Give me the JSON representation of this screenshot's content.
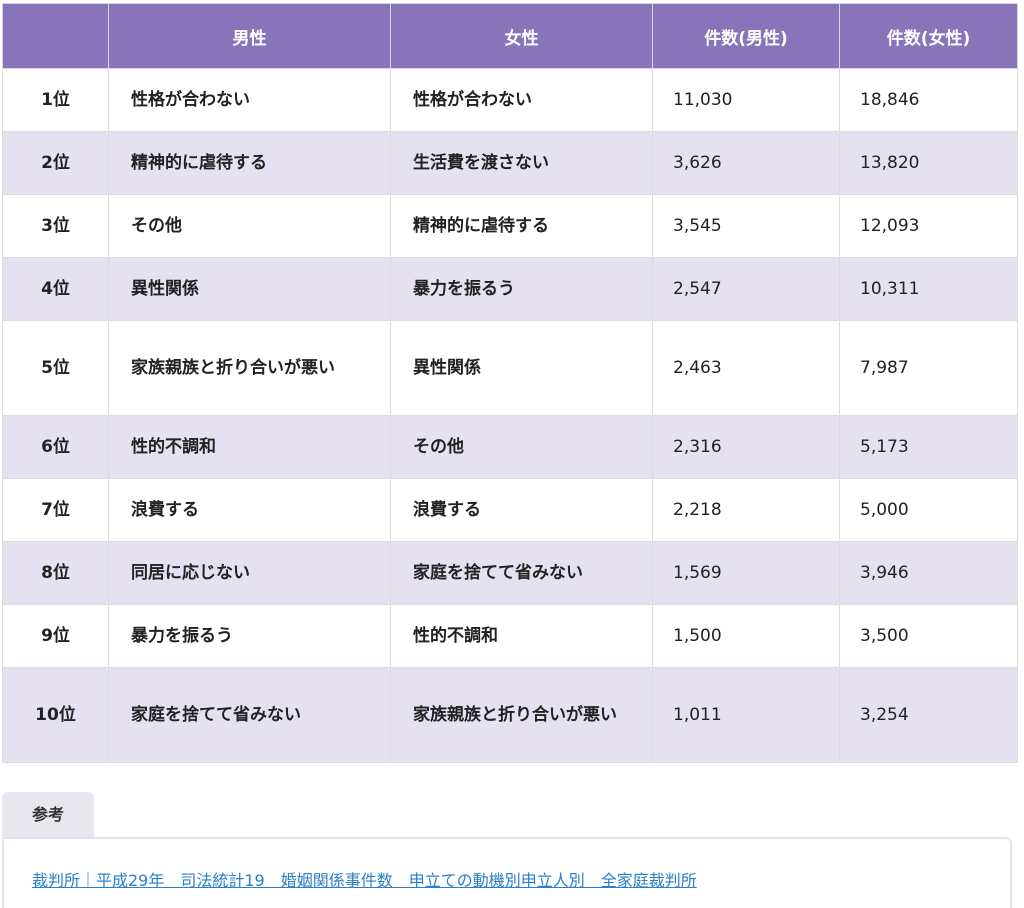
{
  "table": {
    "headers": [
      "",
      "男性",
      "女性",
      "件数(男性)",
      "件数(女性)"
    ],
    "rows": [
      {
        "rank": "1位",
        "male": "性格が合わない",
        "female": "性格が合わない",
        "count_male": "11,030",
        "count_female": "18,846"
      },
      {
        "rank": "2位",
        "male": "精神的に虐待する",
        "female": "生活費を渡さない",
        "count_male": "3,626",
        "count_female": "13,820"
      },
      {
        "rank": "3位",
        "male": "その他",
        "female": "精神的に虐待する",
        "count_male": "3,545",
        "count_female": "12,093"
      },
      {
        "rank": "4位",
        "male": "異性関係",
        "female": "暴力を振るう",
        "count_male": "2,547",
        "count_female": "10,311"
      },
      {
        "rank": "5位",
        "male": "家族親族と折り合いが悪い",
        "female": "異性関係",
        "count_male": "2,463",
        "count_female": "7,987"
      },
      {
        "rank": "6位",
        "male": "性的不調和",
        "female": "その他",
        "count_male": "2,316",
        "count_female": "5,173"
      },
      {
        "rank": "7位",
        "male": "浪費する",
        "female": "浪費する",
        "count_male": "2,218",
        "count_female": "5,000"
      },
      {
        "rank": "8位",
        "male": "同居に応じない",
        "female": "家庭を捨てて省みない",
        "count_male": "1,569",
        "count_female": "3,946"
      },
      {
        "rank": "9位",
        "male": "暴力を振るう",
        "female": "性的不調和",
        "count_male": "1,500",
        "count_female": "3,500"
      },
      {
        "rank": "10位",
        "male": "家庭を捨てて省みない",
        "female": "家族親族と折り合いが悪い",
        "count_male": "1,011",
        "count_female": "3,254"
      }
    ]
  },
  "reference": {
    "tab_label": "参考",
    "link_text": "裁判所｜平成29年　司法統計19　婚姻関係事件数　申立ての動機別申立人別　全家庭裁判所"
  }
}
